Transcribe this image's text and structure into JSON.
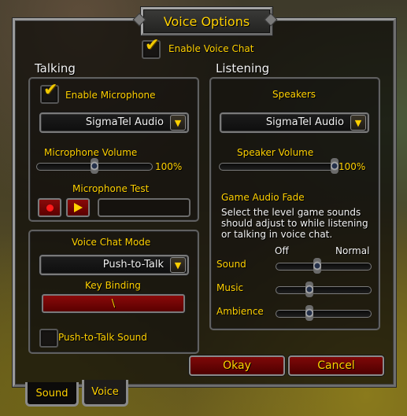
{
  "window": {
    "title": "Voice Options"
  },
  "enable_voice_chat": {
    "label": "Enable Voice Chat",
    "checked": true
  },
  "talking": {
    "heading": "Talking",
    "enable_microphone": {
      "label": "Enable Microphone",
      "checked": true
    },
    "input_device": {
      "selected": "SigmaTel Audio"
    },
    "microphone_volume": {
      "label": "Microphone Volume",
      "value_text": "100%",
      "level": 0.5
    },
    "microphone_test": {
      "label": "Microphone Test",
      "record_icon": "record-icon",
      "play_icon": "play-icon"
    },
    "voice_chat_mode": {
      "label": "Voice Chat Mode",
      "selected": "Push-to-Talk"
    },
    "key_binding": {
      "label": "Key Binding",
      "value": "\\"
    },
    "push_to_talk_sound": {
      "label": "Push-to-Talk Sound",
      "checked": false
    }
  },
  "listening": {
    "heading": "Listening",
    "speakers": {
      "label": "Speakers",
      "selected": "SigmaTel Audio"
    },
    "speaker_volume": {
      "label": "Speaker Volume",
      "value_text": "100%",
      "level": 1.0
    },
    "game_audio_fade": {
      "title": "Game Audio Fade",
      "description": "Select the level game sounds should adjust to while listening or talking in voice chat.",
      "scale_min": "Off",
      "scale_max": "Normal",
      "sliders": [
        {
          "label": "Sound",
          "level": 0.43
        },
        {
          "label": "Music",
          "level": 0.35
        },
        {
          "label": "Ambience",
          "level": 0.35
        }
      ]
    }
  },
  "buttons": {
    "okay": "Okay",
    "cancel": "Cancel"
  },
  "tabs": [
    {
      "label": "Sound",
      "active": false
    },
    {
      "label": "Voice",
      "active": true
    }
  ],
  "colors": {
    "gold_text": "#ffd100",
    "button_red": "#7e0808",
    "frame_grey": "#8a8a8a"
  }
}
